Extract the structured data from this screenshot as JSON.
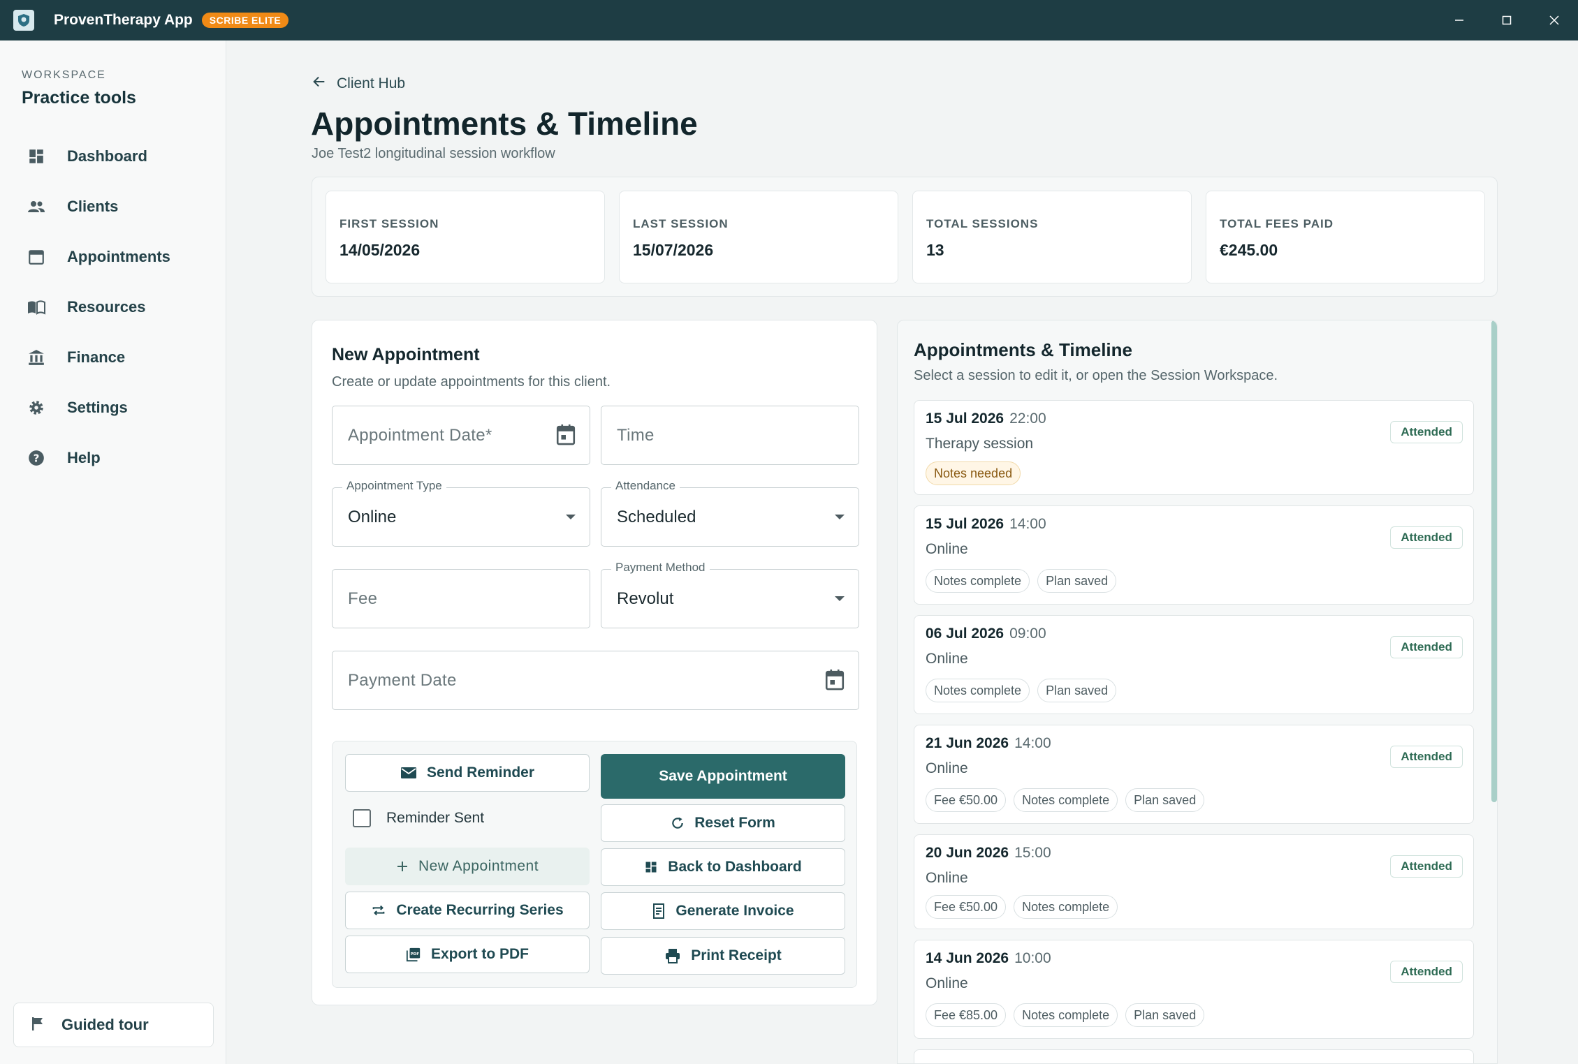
{
  "app": {
    "title": "ProvenTherapy App",
    "badge": "SCRIBE ELITE"
  },
  "sidebar": {
    "kicker": "WORKSPACE",
    "title": "Practice tools",
    "items": [
      {
        "label": "Dashboard",
        "icon": "dashboard-icon"
      },
      {
        "label": "Clients",
        "icon": "people-icon"
      },
      {
        "label": "Appointments",
        "icon": "calendar-icon"
      },
      {
        "label": "Resources",
        "icon": "book-icon"
      },
      {
        "label": "Finance",
        "icon": "bank-icon"
      },
      {
        "label": "Settings",
        "icon": "gear-icon"
      },
      {
        "label": "Help",
        "icon": "help-icon"
      }
    ],
    "tour": "Guided tour"
  },
  "header": {
    "back": "Client Hub",
    "title": "Appointments & Timeline",
    "subtitle": "Joe Test2 longitudinal session workflow"
  },
  "stats": [
    {
      "label": "FIRST SESSION",
      "value": "14/05/2026"
    },
    {
      "label": "LAST SESSION",
      "value": "15/07/2026"
    },
    {
      "label": "TOTAL SESSIONS",
      "value": "13"
    },
    {
      "label": "TOTAL FEES PAID",
      "value": "€245.00"
    }
  ],
  "form": {
    "title": "New Appointment",
    "subtitle": "Create or update appointments for this client.",
    "date_placeholder": "Appointment Date*",
    "time_placeholder": "Time",
    "type_label": "Appointment Type",
    "type_value": "Online",
    "attendance_label": "Attendance",
    "attendance_value": "Scheduled",
    "fee_placeholder": "Fee",
    "payment_method_label": "Payment Method",
    "payment_method_value": "Revolut",
    "payment_date_placeholder": "Payment Date",
    "reminder_checked": false,
    "buttons": {
      "send_reminder": "Send Reminder",
      "save": "Save Appointment",
      "reminder_sent": "Reminder Sent",
      "reset": "Reset Form",
      "new_appointment": "New Appointment",
      "back_dashboard": "Back to Dashboard",
      "recurring": "Create Recurring Series",
      "invoice": "Generate Invoice",
      "export_pdf": "Export to PDF",
      "print_receipt": "Print Receipt"
    }
  },
  "timeline": {
    "title": "Appointments & Timeline",
    "subtitle": "Select a session to edit it, or open the Session Workspace.",
    "items": [
      {
        "date": "15 Jul 2026",
        "time": "22:00",
        "type": "Therapy session",
        "status": "Attended",
        "chips": [
          "Notes needed"
        ]
      },
      {
        "date": "15 Jul 2026",
        "time": "14:00",
        "type": "Online",
        "status": "Attended",
        "chips": [
          "Notes complete",
          "Plan saved"
        ]
      },
      {
        "date": "06 Jul 2026",
        "time": "09:00",
        "type": "Online",
        "status": "Attended",
        "chips": [
          "Notes complete",
          "Plan saved"
        ]
      },
      {
        "date": "21 Jun 2026",
        "time": "14:00",
        "type": "Online",
        "status": "Attended",
        "chips": [
          "Fee €50.00",
          "Notes complete",
          "Plan saved"
        ]
      },
      {
        "date": "20 Jun 2026",
        "time": "15:00",
        "type": "Online",
        "status": "Attended",
        "chips": [
          "Fee €50.00",
          "Notes complete"
        ]
      },
      {
        "date": "14 Jun 2026",
        "time": "10:00",
        "type": "Online",
        "status": "Attended",
        "chips": [
          "Fee €85.00",
          "Notes complete",
          "Plan saved"
        ]
      }
    ]
  },
  "colors": {
    "titlebar": "#1e3d44",
    "primary": "#2b6a6a",
    "badge": "#f08a16",
    "attended": "#2e6b54"
  }
}
